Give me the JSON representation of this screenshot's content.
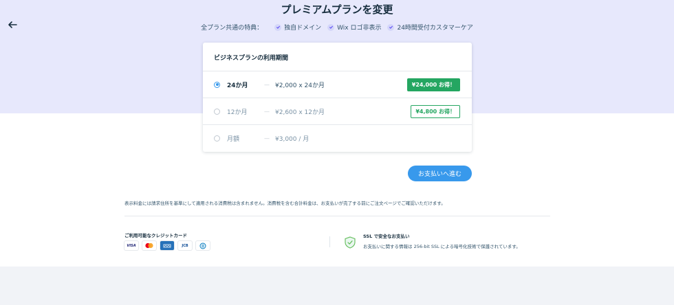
{
  "header": {
    "title": "プレミアムプランを変更",
    "back_icon": "arrow-left-icon",
    "perks_lead": "全プラン共通の特典：",
    "perks": [
      "独自ドメイン",
      "Wix ロゴ非表示",
      "24時間受付カスタマーケア"
    ]
  },
  "plan_card": {
    "title": "ビジネスプランの利用期間",
    "options": [
      {
        "term": "24か月",
        "dash": "—",
        "price": "¥2,000 x 24か月",
        "badge": "¥24,000 お得！",
        "selected": true
      },
      {
        "term": "12か月",
        "dash": "—",
        "price": "¥2,600 x 12か月",
        "badge": "¥4,800 お得！",
        "selected": false
      },
      {
        "term": "月額",
        "dash": "—",
        "price": "¥3,000 / 月",
        "badge": "",
        "selected": false
      }
    ]
  },
  "checkout": {
    "button_label": "お支払いへ進む"
  },
  "footer": {
    "tax_note": "表示料金には請求住所を基準にして適用される消費税は含まれません。消費税を含む合計料金は、お支払いが完了する前にご注文ページでご確認いただけます。",
    "cards_title": "ご利用可能なクレジットカード",
    "card_labels": {
      "visa": "VISA",
      "jcb": "JCB"
    },
    "ssl_title": "SSL で安全なお支払い",
    "ssl_text": "お支払いに関する情報は 256-bit SSL による暗号化技術で保護されています。"
  },
  "colors": {
    "hero_bg": "#e7e8fc",
    "accent_blue": "#3899ec",
    "savings_green": "#24a661",
    "text_dark": "#162d3d"
  }
}
